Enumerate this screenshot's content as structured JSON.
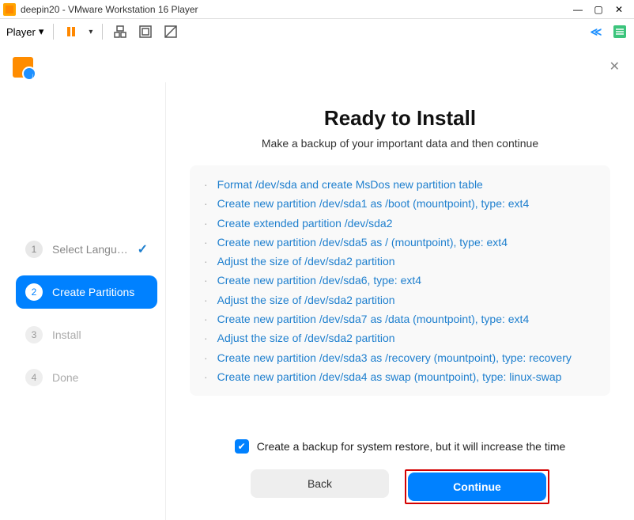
{
  "window": {
    "title": "deepin20 - VMware Workstation 16 Player",
    "player_label": "Player"
  },
  "installer": {
    "title": "Ready to Install",
    "subtitle": "Make a backup of your important data and then continue",
    "plan": [
      "Format /dev/sda and create MsDos new partition table",
      "Create new partition /dev/sda1 as /boot (mountpoint), type: ext4",
      "Create extended partition /dev/sda2",
      "Create new partition /dev/sda5 as / (mountpoint), type: ext4",
      "Adjust the size of /dev/sda2 partition",
      "Create new partition /dev/sda6, type: ext4",
      "Adjust the size of /dev/sda2 partition",
      "Create new partition /dev/sda7 as /data (mountpoint), type: ext4",
      "Adjust the size of /dev/sda2 partition",
      "Create new partition /dev/sda3 as /recovery (mountpoint), type: recovery",
      "Create new partition /dev/sda4 as swap (mountpoint), type: linux-swap"
    ],
    "backup_label": "Create a backup for system restore, but it will increase the time",
    "back_btn": "Back",
    "continue_btn": "Continue",
    "steps": {
      "s1": "Select Langu…",
      "s2": "Create Partitions",
      "s3": "Install",
      "s4": "Done"
    }
  }
}
